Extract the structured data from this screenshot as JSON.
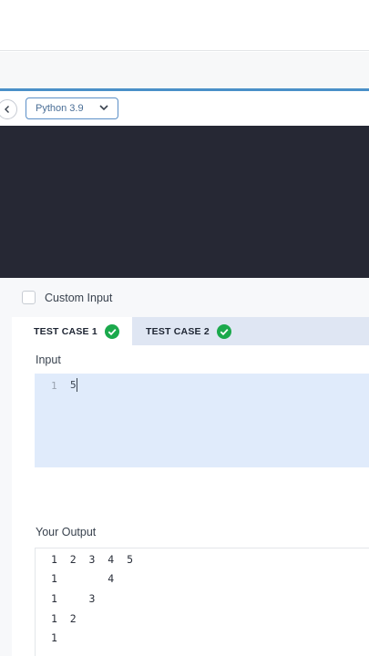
{
  "toolbar": {
    "back_icon": "chevron-left-icon",
    "language": "Python 3.9",
    "dropdown_icon": "chevron-down-icon"
  },
  "panel": {
    "custom_input_label": "Custom Input",
    "tabs": [
      {
        "label": "TEST CASE 1",
        "status_icon": "check-circle-icon",
        "active": true
      },
      {
        "label": "TEST CASE 2",
        "status_icon": "check-circle-icon",
        "active": false
      }
    ],
    "input": {
      "label": "Input",
      "line_number": "1",
      "value": "5"
    },
    "output": {
      "label": "Your Output",
      "lines": [
        "1  2  3  4  5",
        "1        4",
        "1     3",
        "1  2",
        "1"
      ]
    }
  },
  "colors": {
    "accent": "#4a90c8",
    "editor_bg": "#262834",
    "success": "#1ba94c",
    "input_bg": "#e0ebfb",
    "tab_bar": "#dfe6f3"
  }
}
